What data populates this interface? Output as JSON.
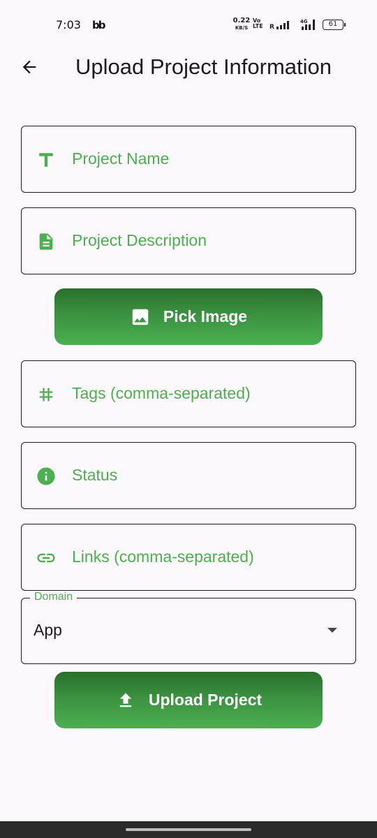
{
  "status_bar": {
    "time": "7:03",
    "app_indicator": "bb",
    "net_speed": "0.22",
    "net_speed_unit": "KB/S",
    "volte": "Vo LTE",
    "battery": "61"
  },
  "app_bar": {
    "title": "Upload Project Information",
    "back_icon": "arrow-back-icon"
  },
  "form": {
    "project_name": {
      "label": "Project Name",
      "icon": "title-t-icon"
    },
    "project_description": {
      "label": "Project Description",
      "icon": "description-icon"
    },
    "pick_image": {
      "label": "Pick Image",
      "icon": "image-icon"
    },
    "tags": {
      "label": "Tags (comma-separated)",
      "icon": "hashtag-icon"
    },
    "status": {
      "label": "Status",
      "icon": "info-icon"
    },
    "links": {
      "label": "Links (comma-separated)",
      "icon": "link-icon"
    },
    "domain": {
      "label": "Domain",
      "value": "App",
      "icon": "dropdown-arrow-icon"
    },
    "upload": {
      "label": "Upload Project",
      "icon": "upload-icon"
    }
  },
  "colors": {
    "accent": "#4caf50",
    "button_dark": "#2a6f2c",
    "background": "#fdf8fc",
    "text": "#1c1b1f"
  }
}
